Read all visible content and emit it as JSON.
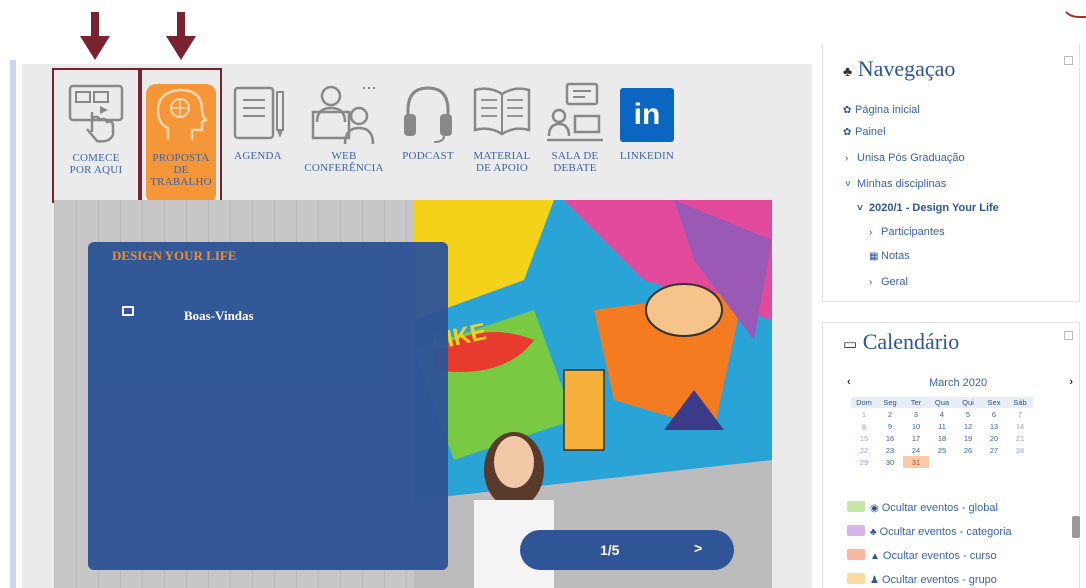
{
  "colors": {
    "arrow": "#7a2330",
    "accent_blue": "#2f5596",
    "orange": "#f59638",
    "linkedin": "#0b66c2"
  },
  "iconbar": [
    {
      "name": "comece",
      "label_line1": "COMECE",
      "label_line2": "POR AQUI",
      "icon": "touch-screen-icon"
    },
    {
      "name": "proposta",
      "label_line1": "PROPOSTA",
      "label_line2": "DE",
      "label_line3": "TRABALHO",
      "icon": "brain-head-icon"
    },
    {
      "name": "agenda",
      "label_line1": "AGENDA",
      "icon": "notebook-icon"
    },
    {
      "name": "web",
      "label_line1": "WEB",
      "label_line2": "CONFERÊNCIA",
      "icon": "video-conference-icon"
    },
    {
      "name": "podcast",
      "label_line1": "PODCAST",
      "icon": "headphones-icon"
    },
    {
      "name": "material",
      "label_line1": "MATERIAL",
      "label_line2": "DE APOIO",
      "icon": "open-book-icon"
    },
    {
      "name": "sala",
      "label_line1": "SALA DE",
      "label_line2": "DEBATE",
      "icon": "chat-people-icon"
    },
    {
      "name": "linkedin",
      "label_line1": "LINKEDIN",
      "icon": "linkedin-icon",
      "logo_text": "in"
    }
  ],
  "banner": {
    "panel_title": "DESIGN YOUR LIFE",
    "link_label": "Boas-Vindas",
    "pager_text": "1/5",
    "next_glyph": ">"
  },
  "navigation": {
    "title": "Navegaçao",
    "items": [
      {
        "label": "Página inicial",
        "icon": "dashboard-icon"
      },
      {
        "label": "Painel",
        "icon": "dashboard-icon"
      },
      {
        "label": "Unisa Pós Graduação",
        "icon": "chevron-right-icon"
      },
      {
        "label": "Minhas disciplinas",
        "icon": "chevron-down-icon"
      },
      {
        "label": "2020/1 - Design Your Life",
        "icon": "chevron-down-icon"
      },
      {
        "label": "Participantes",
        "icon": "chevron-right-icon"
      },
      {
        "label": "Notas",
        "icon": "table-icon"
      },
      {
        "label": "Geral",
        "icon": "chevron-right-icon"
      }
    ]
  },
  "calendar": {
    "title": "Calendário",
    "month": "March 2020",
    "prev_glyph": "‹",
    "next_glyph": "›",
    "weekdays": [
      "Dom",
      "Seg",
      "Ter",
      "Qua",
      "Qui",
      "Sex",
      "Sáb"
    ],
    "weeks": [
      [
        "1",
        "2",
        "3",
        "4",
        "5",
        "6",
        "7"
      ],
      [
        "8",
        "9",
        "10",
        "11",
        "12",
        "13",
        "14"
      ],
      [
        "15",
        "16",
        "17",
        "18",
        "19",
        "20",
        "21"
      ],
      [
        "22",
        "23",
        "24",
        "25",
        "26",
        "27",
        "28"
      ],
      [
        "29",
        "30",
        "31",
        "",
        "",
        "",
        ""
      ]
    ],
    "today": "31",
    "events": [
      {
        "label": "Ocultar eventos - global",
        "color": "#c7e6a8",
        "icon": "globe-icon"
      },
      {
        "label": "Ocultar eventos - categoria",
        "color": "#d8b4e6",
        "icon": "sitemap-icon"
      },
      {
        "label": "Ocultar eventos - curso",
        "color": "#f7b9a3",
        "icon": "graduation-cap-icon"
      },
      {
        "label": "Ocultar eventos - grupo",
        "color": "#f9dca0",
        "icon": "users-icon"
      }
    ]
  }
}
